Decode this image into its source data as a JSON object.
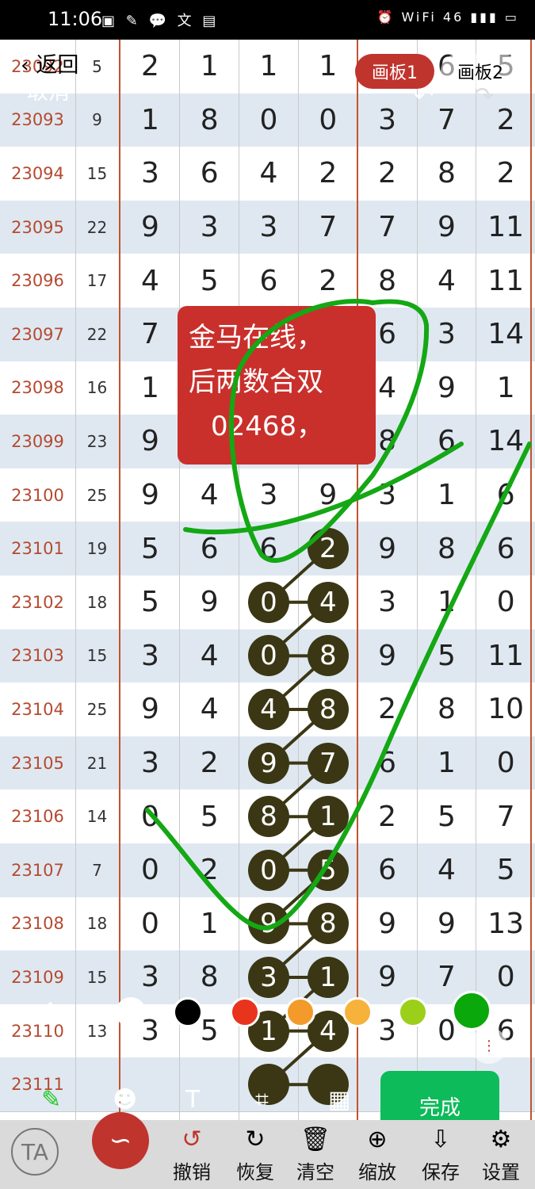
{
  "status_bar": {
    "time": "11:06",
    "app_icons": "▣ ✎ 💬 文 ▤",
    "indicators": "⏰ WiFi 46 ▮▮▮ ▭"
  },
  "top_bar": {
    "back_label": "返回",
    "cancel_label": "取消",
    "board1_label": "画板1",
    "board2_label": "画板2",
    "undo_icon": "↶",
    "redo_icon": "↷"
  },
  "grid": {
    "rows": [
      {
        "id": "23092",
        "sum": "5",
        "d": [
          "2",
          "1",
          "1",
          "1",
          "",
          "6",
          "5"
        ]
      },
      {
        "id": "23093",
        "sum": "9",
        "d": [
          "1",
          "8",
          "0",
          "0",
          "3",
          "7",
          "2"
        ]
      },
      {
        "id": "23094",
        "sum": "15",
        "d": [
          "3",
          "6",
          "4",
          "2",
          "2",
          "8",
          "2"
        ]
      },
      {
        "id": "23095",
        "sum": "22",
        "d": [
          "9",
          "3",
          "3",
          "7",
          "7",
          "9",
          "11"
        ]
      },
      {
        "id": "23096",
        "sum": "17",
        "d": [
          "4",
          "5",
          "6",
          "2",
          "8",
          "4",
          "11"
        ]
      },
      {
        "id": "23097",
        "sum": "22",
        "d": [
          "7",
          "",
          "",
          "",
          "6",
          "3",
          "14"
        ]
      },
      {
        "id": "23098",
        "sum": "16",
        "d": [
          "1",
          "",
          "",
          "",
          "4",
          "9",
          "1"
        ]
      },
      {
        "id": "23099",
        "sum": "23",
        "d": [
          "9",
          "",
          "",
          "",
          "8",
          "6",
          "14"
        ]
      },
      {
        "id": "23100",
        "sum": "25",
        "d": [
          "9",
          "4",
          "3",
          "9",
          "3",
          "1",
          "6"
        ]
      },
      {
        "id": "23101",
        "sum": "19",
        "d": [
          "5",
          "6",
          "6",
          "",
          "9",
          "8",
          "6"
        ]
      },
      {
        "id": "23102",
        "sum": "18",
        "d": [
          "5",
          "9",
          "",
          "",
          "3",
          "1",
          "0"
        ]
      },
      {
        "id": "23103",
        "sum": "15",
        "d": [
          "3",
          "4",
          "",
          "",
          "9",
          "5",
          "11"
        ]
      },
      {
        "id": "23104",
        "sum": "25",
        "d": [
          "9",
          "4",
          "",
          "",
          "2",
          "8",
          "10"
        ]
      },
      {
        "id": "23105",
        "sum": "21",
        "d": [
          "3",
          "2",
          "",
          "",
          "6",
          "1",
          "0"
        ]
      },
      {
        "id": "23106",
        "sum": "14",
        "d": [
          "0",
          "5",
          "",
          "",
          "2",
          "5",
          "7"
        ]
      },
      {
        "id": "23107",
        "sum": "7",
        "d": [
          "0",
          "2",
          "",
          "",
          "6",
          "4",
          "5"
        ]
      },
      {
        "id": "23108",
        "sum": "18",
        "d": [
          "0",
          "1",
          "",
          "",
          "9",
          "9",
          "13"
        ]
      },
      {
        "id": "23109",
        "sum": "15",
        "d": [
          "3",
          "8",
          "",
          "",
          "9",
          "7",
          "0"
        ]
      },
      {
        "id": "23110",
        "sum": "13",
        "d": [
          "3",
          "5",
          "",
          "",
          "3",
          "0",
          "6"
        ]
      },
      {
        "id": "23111",
        "sum": "",
        "d": [
          "",
          "",
          "",
          "",
          "",
          "",
          ""
        ]
      }
    ],
    "balls": [
      {
        "row": 9,
        "col": 3,
        "text": "2"
      },
      {
        "row": 10,
        "col": 2,
        "text": "0"
      },
      {
        "row": 10,
        "col": 3,
        "text": "4"
      },
      {
        "row": 11,
        "col": 2,
        "text": "0"
      },
      {
        "row": 11,
        "col": 3,
        "text": "8"
      },
      {
        "row": 12,
        "col": 2,
        "text": "4"
      },
      {
        "row": 12,
        "col": 3,
        "text": "8"
      },
      {
        "row": 13,
        "col": 2,
        "text": "9"
      },
      {
        "row": 13,
        "col": 3,
        "text": "7"
      },
      {
        "row": 14,
        "col": 2,
        "text": "8"
      },
      {
        "row": 14,
        "col": 3,
        "text": "1"
      },
      {
        "row": 15,
        "col": 2,
        "text": "0"
      },
      {
        "row": 15,
        "col": 3,
        "text": "5"
      },
      {
        "row": 16,
        "col": 2,
        "text": "9"
      },
      {
        "row": 16,
        "col": 3,
        "text": "8"
      },
      {
        "row": 17,
        "col": 2,
        "text": "3"
      },
      {
        "row": 17,
        "col": 3,
        "text": "1"
      },
      {
        "row": 18,
        "col": 2,
        "text": "1"
      },
      {
        "row": 18,
        "col": 3,
        "text": "4"
      },
      {
        "row": 19,
        "col": 2,
        "text": ""
      },
      {
        "row": 19,
        "col": 3,
        "text": ""
      }
    ]
  },
  "note": {
    "line1": "金马在线，",
    "line2": "后两数合双",
    "line3": "02468，",
    "color": "#c9302c"
  },
  "palette": {
    "eraser_icon": "◇",
    "colors": [
      "#ffffff",
      "#000000",
      "#e8341c",
      "#f39a2b",
      "#f7b23b",
      "#9ccf1a",
      "#0aa80a"
    ],
    "selected": "#0aa80a"
  },
  "tools": {
    "pen_icon": "✎",
    "emoji_icon": "☻",
    "text_icon": "T",
    "crop_icon": "⌗",
    "mosaic_icon": "▦",
    "done_label": "完成",
    "side_toggle_icon": "⋮"
  },
  "bottom_bar": {
    "ta_label": "TA",
    "draw_icon": "∽",
    "actions": [
      {
        "label": "撤销",
        "icon": "↺"
      },
      {
        "label": "恢复",
        "icon": "↻"
      },
      {
        "label": "清空",
        "icon": "🗑"
      },
      {
        "label": "缩放",
        "icon": "⊕"
      },
      {
        "label": "保存",
        "icon": "⇩"
      },
      {
        "label": "设置",
        "icon": "⚙"
      }
    ]
  },
  "annotation": {
    "stroke_color": "#14a814"
  }
}
